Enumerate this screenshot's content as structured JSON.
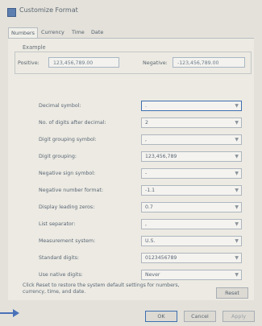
{
  "window": {
    "title": "Customize Format"
  },
  "tabs": [
    "Numbers",
    "Currency",
    "Time",
    "Date"
  ],
  "example": {
    "label": "Example",
    "positive_label": "Positive:",
    "positive_value": "123,456,789.00",
    "negative_label": "Negative:",
    "negative_value": "-123,456,789.00"
  },
  "settings": [
    {
      "label": "Decimal symbol:",
      "value": "."
    },
    {
      "label": "No. of digits after decimal:",
      "value": "2"
    },
    {
      "label": "Digit grouping symbol:",
      "value": ","
    },
    {
      "label": "Digit grouping:",
      "value": "123,456,789"
    },
    {
      "label": "Negative sign symbol:",
      "value": "-"
    },
    {
      "label": "Negative number format:",
      "value": "-1.1"
    },
    {
      "label": "Display leading zeros:",
      "value": "0.7"
    },
    {
      "label": "List separator:",
      "value": ","
    },
    {
      "label": "Measurement system:",
      "value": "U.S."
    },
    {
      "label": "Standard digits:",
      "value": "0123456789"
    },
    {
      "label": "Use native digits:",
      "value": "Never"
    }
  ],
  "footer": {
    "text": "Click Reset to restore the system default settings for numbers, currency, time, and date.",
    "reset_label": "Reset"
  },
  "buttons": {
    "ok": "OK",
    "cancel": "Cancel",
    "apply": "Apply"
  }
}
